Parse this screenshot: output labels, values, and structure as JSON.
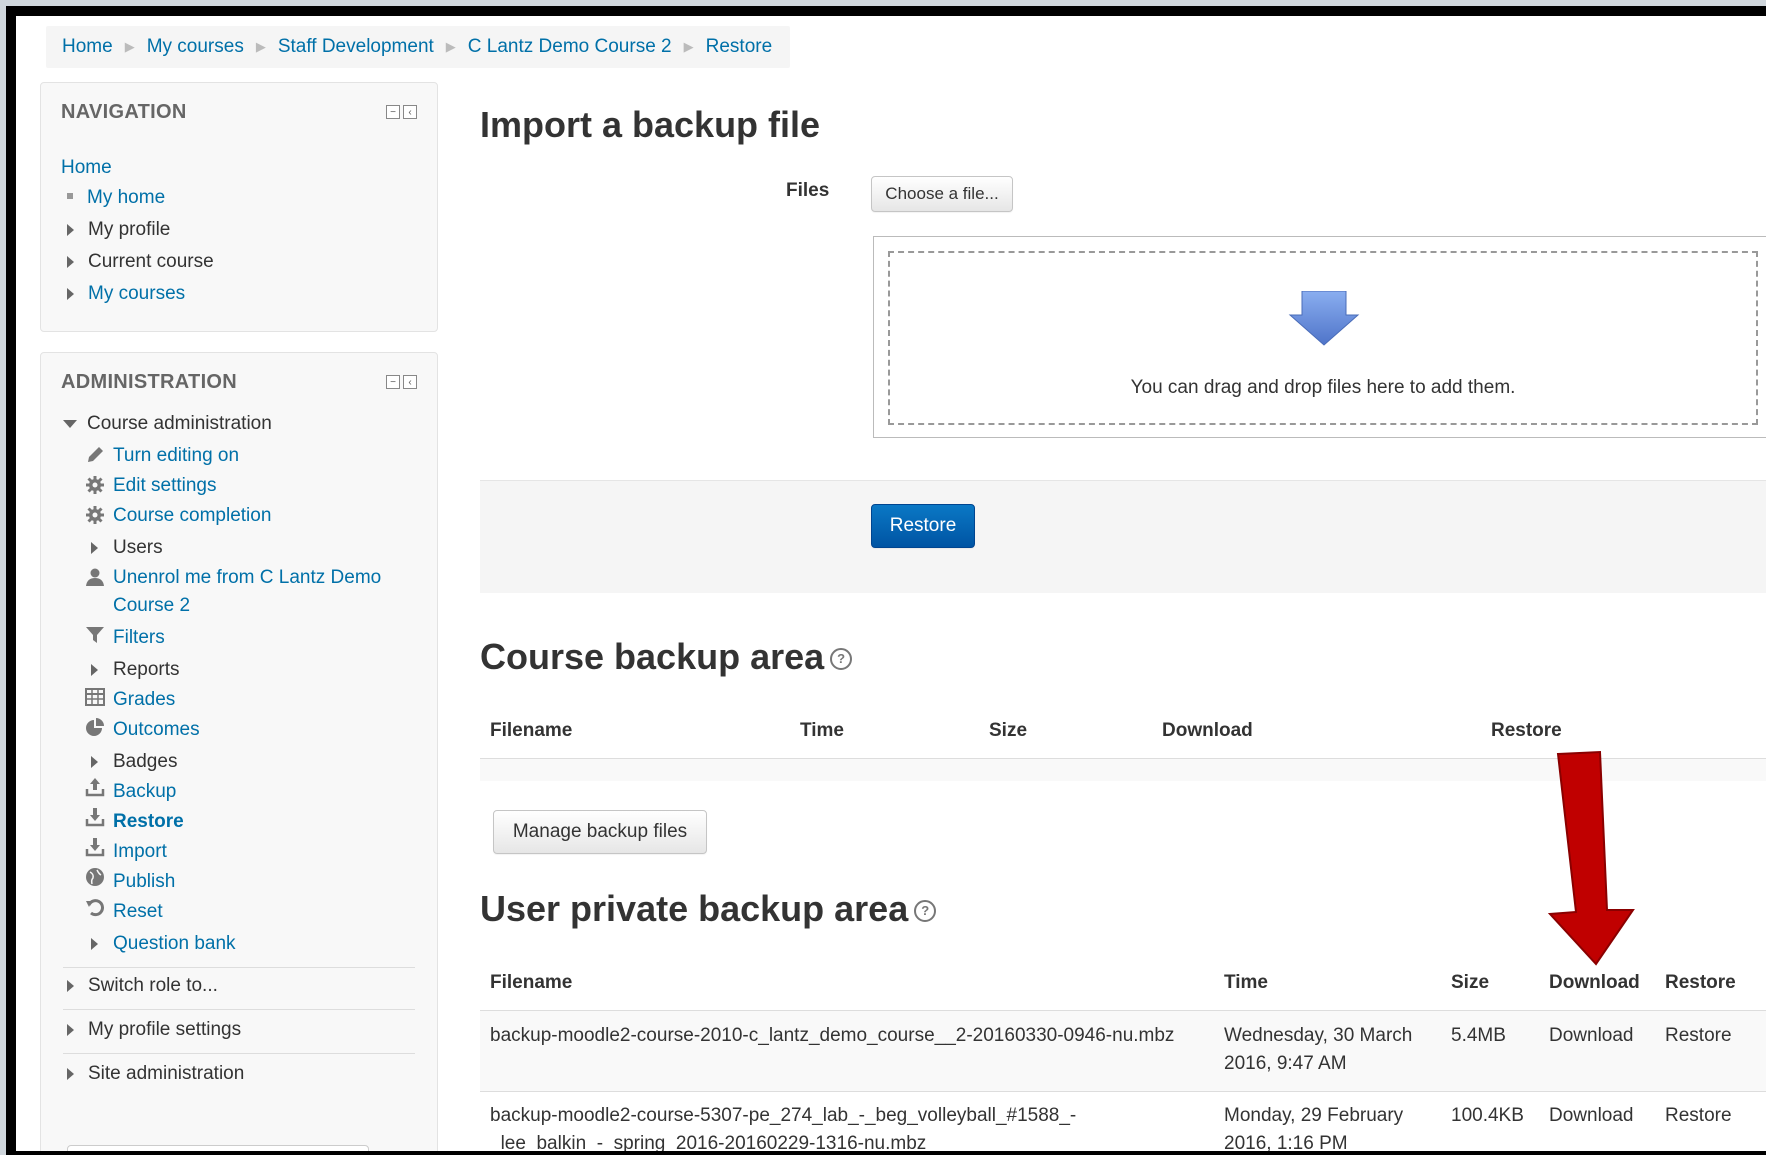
{
  "breadcrumb": [
    "Home",
    "My courses",
    "Staff Development",
    "C Lantz Demo Course 2",
    "Restore"
  ],
  "navigation": {
    "title": "NAVIGATION",
    "home": "Home",
    "items": [
      "My home",
      "My profile",
      "Current course",
      "My courses"
    ]
  },
  "administration": {
    "title": "ADMINISTRATION",
    "course_admin": "Course administration",
    "items": {
      "turn_editing": "Turn editing on",
      "edit_settings": "Edit settings",
      "course_completion": "Course completion",
      "users": "Users",
      "unenrol_1": "Unenrol me from C Lantz Demo",
      "unenrol_2": "Course 2",
      "filters": "Filters",
      "reports": "Reports",
      "grades": "Grades",
      "outcomes": "Outcomes",
      "badges": "Badges",
      "backup": "Backup",
      "restore": "Restore",
      "import": "Import",
      "publish": "Publish",
      "reset": "Reset",
      "question_bank": "Question bank"
    },
    "switch_role": "Switch role to...",
    "my_profile_settings": "My profile settings",
    "site_administration": "Site administration"
  },
  "import": {
    "heading": "Import a backup file",
    "files_label": "Files",
    "choose_button": "Choose a file...",
    "dropzone_text": "You can drag and drop files here to add them.",
    "restore_button": "Restore"
  },
  "course_backup": {
    "heading": "Course backup area",
    "columns": [
      "Filename",
      "Time",
      "Size",
      "Download",
      "Restore"
    ],
    "manage_button": "Manage backup files"
  },
  "user_backup": {
    "heading": "User private backup area",
    "columns": [
      "Filename",
      "Time",
      "Size",
      "Download",
      "Restore"
    ],
    "rows": [
      {
        "filename_1": "backup-moodle2-course-2010-c_lantz_demo_course__2-20160330-0946-nu.mbz",
        "filename_2": "",
        "time_1": "Wednesday, 30 March",
        "time_2": "2016, 9:47 AM",
        "size": "5.4MB",
        "download": "Download",
        "restore": "Restore"
      },
      {
        "filename_1": "backup-moodle2-course-5307-pe_274_lab_-_beg_volleyball_#1588_-",
        "filename_2": "_lee_balkin_-_spring_2016-20160229-1316-nu.mbz",
        "time_1": "Monday, 29 February",
        "time_2": "2016, 1:16 PM",
        "size": "100.4KB",
        "download": "Download",
        "restore": "Restore"
      }
    ]
  },
  "colors": {
    "link": "#0070a8",
    "primary_button": "#0a6bbd",
    "arrow": "#c00000",
    "dropzone_arrow": "#6b8fd6"
  }
}
